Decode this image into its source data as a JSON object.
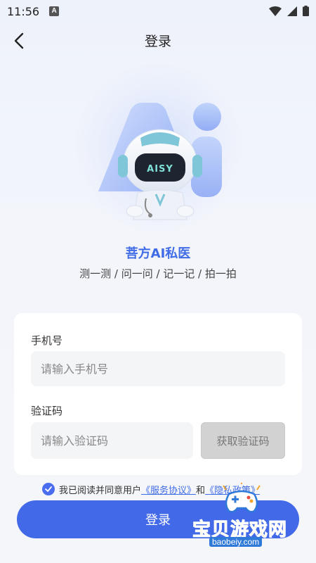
{
  "status_bar": {
    "time": "11:56",
    "notification_icon": "A"
  },
  "nav": {
    "title": "登录",
    "back_icon": "chevron-left-icon"
  },
  "hero": {
    "logo_text": "Ai",
    "robot_badge": "AISY"
  },
  "brand": {
    "name": "菩方AI私医",
    "slogan": "测一测 / 问一问 / 记一记 / 拍一拍"
  },
  "form": {
    "phone_label": "手机号",
    "phone_placeholder": "请输入手机号",
    "phone_value": "",
    "code_label": "验证码",
    "code_placeholder": "请输入验证码",
    "code_value": "",
    "get_code_label": "获取验证码"
  },
  "agreement": {
    "checked": true,
    "prefix": "我已阅读并同意用户",
    "service_link": "《服务协议》",
    "and": "和",
    "privacy_link": "《隐私政策》"
  },
  "login_button": {
    "label": "登录"
  },
  "watermark": {
    "text": "宝贝游戏网",
    "url": "baobeiy.com"
  },
  "colors": {
    "primary": "#4169e8",
    "brand_text": "#3f6be6",
    "disabled_button": "#d2d2d2"
  }
}
